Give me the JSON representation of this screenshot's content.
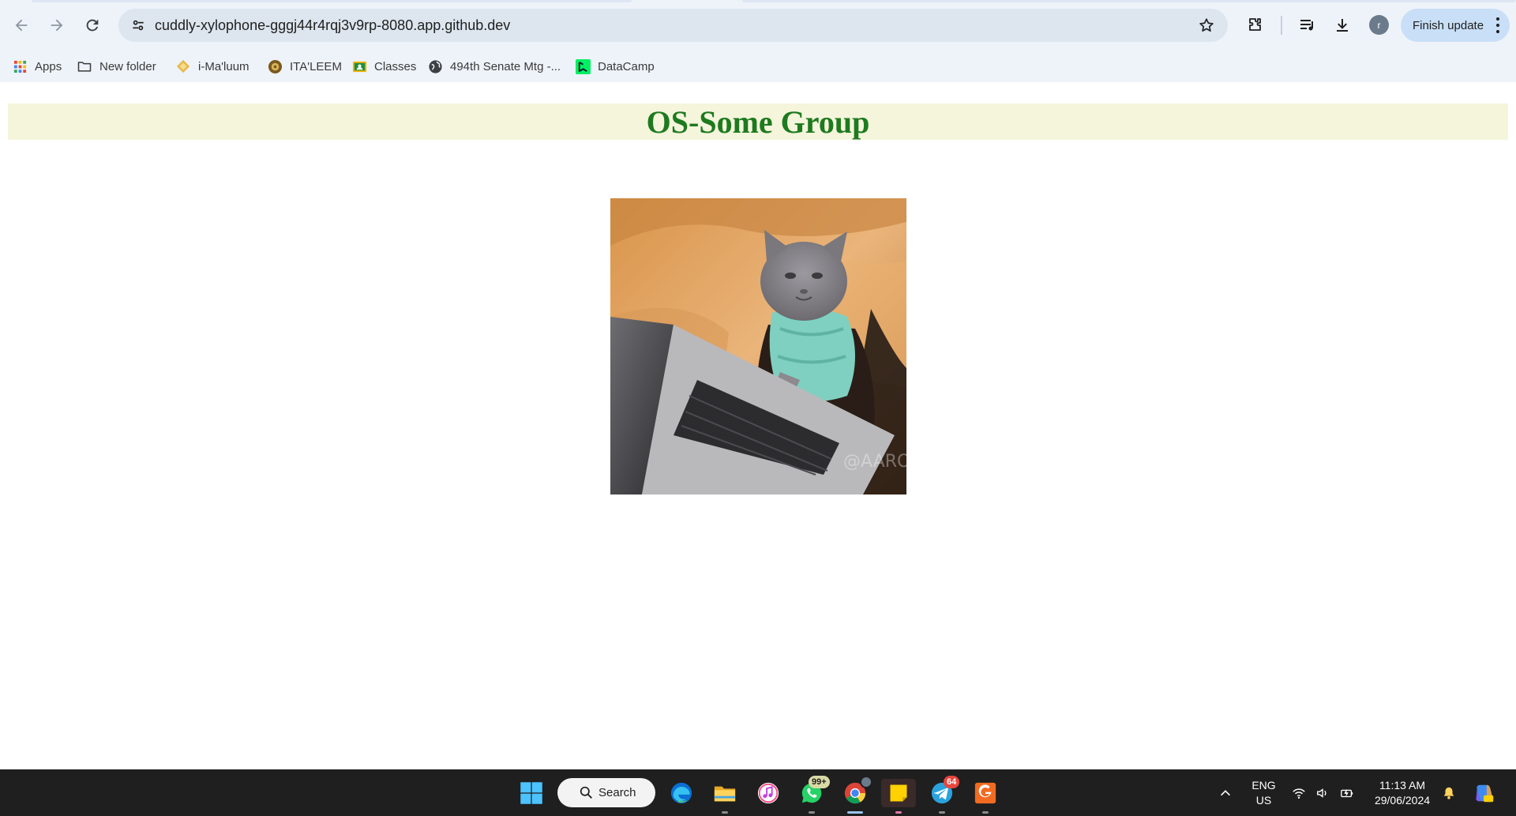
{
  "browser": {
    "url": "cuddly-xylophone-gggj44r4rqj3v9rp-8080.app.github.dev",
    "profile_initial": "r",
    "finish_update_label": "Finish update",
    "icons": {
      "back": "back-arrow-icon",
      "forward": "forward-arrow-icon",
      "reload": "reload-icon",
      "site_info": "tune-icon",
      "bookmark": "star-icon",
      "extensions": "puzzle-icon",
      "media": "media-queue-icon",
      "downloads": "download-icon",
      "menu": "kebab-menu-icon"
    }
  },
  "bookmarks": [
    {
      "label": "Apps",
      "icon": "apps-grid-icon"
    },
    {
      "label": "New folder",
      "icon": "folder-icon"
    },
    {
      "label": "i-Ma'luum",
      "icon": "imaluum-logo-icon"
    },
    {
      "label": "ITA'LEEM",
      "icon": "italeem-logo-icon"
    },
    {
      "label": "Classes",
      "icon": "classroom-icon"
    },
    {
      "label": "494th Senate Mtg -...",
      "icon": "globe-icon"
    },
    {
      "label": "DataCamp",
      "icon": "datacamp-icon"
    }
  ],
  "page": {
    "title": "OS-Some Group",
    "image": {
      "subject": "cat typing on laptop",
      "watermark": "@AARON"
    },
    "colors": {
      "banner_bg": "#f5f5dc",
      "title_color": "#1e7a1e"
    }
  },
  "taskbar": {
    "search_label": "Search",
    "apps": [
      {
        "name": "start",
        "icon": "windows-start-icon"
      },
      {
        "name": "edge",
        "icon": "edge-icon"
      },
      {
        "name": "file-explorer",
        "icon": "folder-icon"
      },
      {
        "name": "itunes",
        "icon": "music-icon"
      },
      {
        "name": "whatsapp",
        "icon": "whatsapp-icon",
        "badge": "99+"
      },
      {
        "name": "chrome",
        "icon": "chrome-icon"
      },
      {
        "name": "sticky-notes",
        "icon": "sticky-notes-icon"
      },
      {
        "name": "telegram",
        "icon": "telegram-icon",
        "badge": "64"
      },
      {
        "name": "pdf-app",
        "icon": "pdf-icon"
      }
    ],
    "tray": {
      "language_line1": "ENG",
      "language_line2": "US",
      "time": "11:13 AM",
      "date": "29/06/2024"
    }
  }
}
